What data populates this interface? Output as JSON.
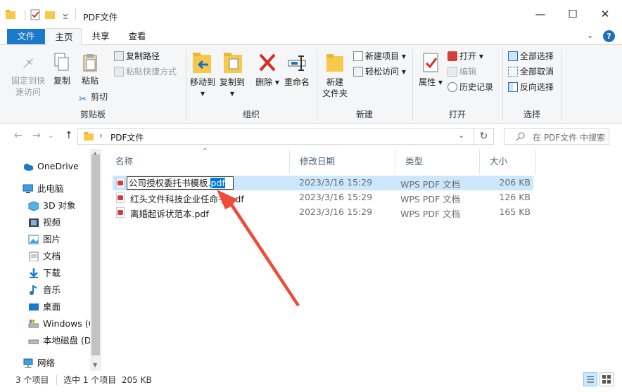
{
  "window": {
    "title": "PDF文件",
    "controls": {
      "minimize": "—",
      "maximize": "☐",
      "close": "✕"
    }
  },
  "tabs": {
    "file": "文件",
    "home": "主页",
    "share": "共享",
    "view": "查看"
  },
  "ribbon": {
    "clipboard": {
      "pin": "固定到快速访问",
      "pin_line1": "固定到快",
      "pin_line2": "速访问",
      "copy": "复制",
      "paste": "粘贴",
      "copy_path": "复制路径",
      "paste_shortcut": "粘贴快捷方式",
      "cut": "剪切",
      "group_label": "剪贴板"
    },
    "organize": {
      "move_to": "移动到",
      "copy_to": "复制到",
      "delete": "删除",
      "rename": "重命名",
      "group_label": "组织"
    },
    "new": {
      "new_folder_line1": "新建",
      "new_folder_line2": "文件夹",
      "new_item": "新建项目",
      "easy_access": "轻松访问",
      "group_label": "新建"
    },
    "open": {
      "properties": "属性",
      "open": "打开",
      "edit": "编辑",
      "history": "历史记录",
      "group_label": "打开"
    },
    "select": {
      "select_all": "全部选择",
      "select_none": "全部取消",
      "invert": "反向选择",
      "group_label": "选择"
    }
  },
  "address": {
    "path": "PDF文件",
    "search_placeholder": "在 PDF文件 中搜索",
    "back": "←",
    "forward": "→",
    "up": "↑",
    "refresh": "↻",
    "separator": "›"
  },
  "nav_pane": {
    "items": [
      {
        "label": "OneDrive",
        "icon": "onedrive-icon"
      },
      {
        "label": "此电脑",
        "icon": "this-pc-icon"
      },
      {
        "label": "3D 对象",
        "icon": "3d-objects-icon"
      },
      {
        "label": "视频",
        "icon": "video-icon"
      },
      {
        "label": "图片",
        "icon": "pictures-icon"
      },
      {
        "label": "文档",
        "icon": "documents-icon"
      },
      {
        "label": "下载",
        "icon": "downloads-icon"
      },
      {
        "label": "音乐",
        "icon": "music-icon"
      },
      {
        "label": "桌面",
        "icon": "desktop-icon"
      },
      {
        "label": "Windows (C",
        "icon": "drive-c-icon"
      },
      {
        "label": "本地磁盘 (D",
        "icon": "drive-d-icon"
      },
      {
        "label": "网络",
        "icon": "network-icon"
      }
    ]
  },
  "file_list": {
    "columns": {
      "name": "名称",
      "date": "修改日期",
      "type": "类型",
      "size": "大小"
    },
    "rows": [
      {
        "name": "公司授权委托书模板.pdf",
        "date": "2023/3/16 15:29",
        "type": "WPS PDF 文档",
        "size": "206 KB",
        "selected": true
      },
      {
        "name": "红头文件科技企业任命书.pdf",
        "date": "2023/3/16 15:29",
        "type": "WPS PDF 文档",
        "size": "126 KB",
        "selected": false
      },
      {
        "name": "离婚起诉状范本.pdf",
        "date": "2023/3/16 15:29",
        "type": "WPS PDF 文档",
        "size": "165 KB",
        "selected": false
      }
    ],
    "rename_box": {
      "base": "公司授权委托书模板.",
      "ext": "pdf"
    }
  },
  "status": {
    "item_count": "3 个项目",
    "selection": "选中 1 个项目  205 KB"
  },
  "colors": {
    "accent": "#1979ca",
    "selection": "#cce8ff",
    "annotation_arrow": "#f04a3a"
  }
}
